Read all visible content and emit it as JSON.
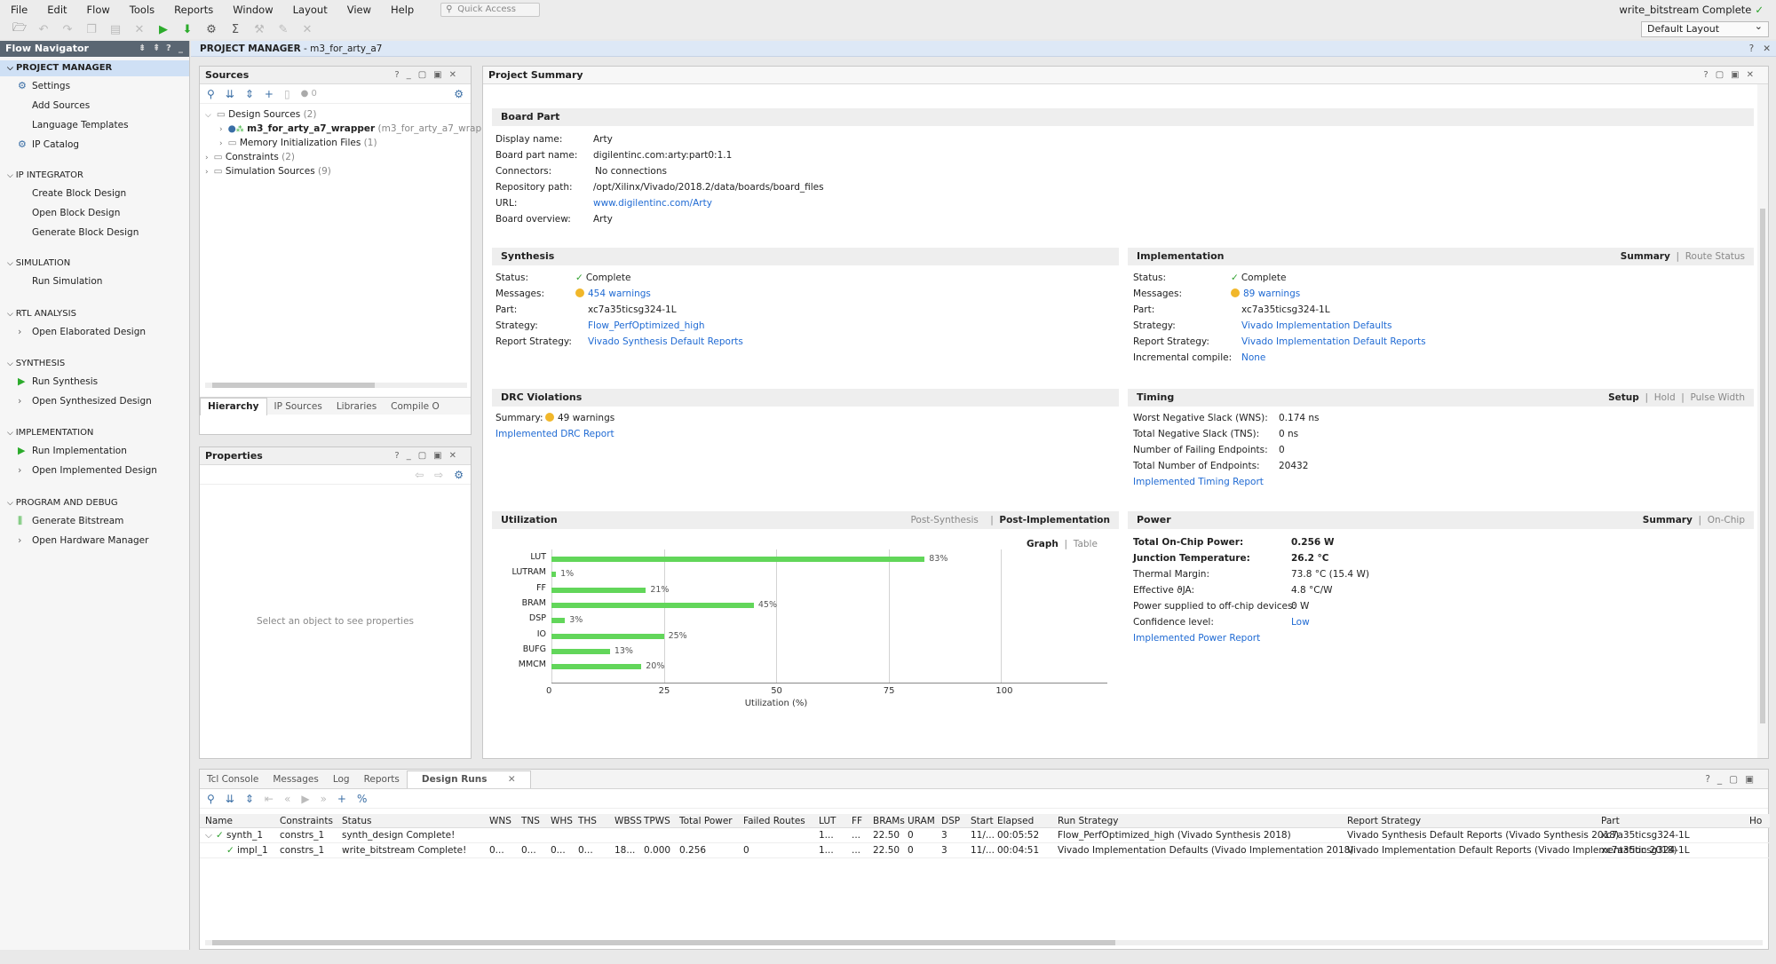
{
  "menu": {
    "items": [
      "File",
      "Edit",
      "Flow",
      "Tools",
      "Reports",
      "Window",
      "Layout",
      "View",
      "Help"
    ],
    "quick_access": "Quick Access"
  },
  "status": {
    "text": "write_bitstream Complete",
    "check": "✓"
  },
  "layout": {
    "selected": "Default Layout"
  },
  "flow_nav": {
    "title": "Flow Navigator",
    "project_manager": "PROJECT MANAGER",
    "settings": "Settings",
    "add_sources": "Add Sources",
    "language_templates": "Language Templates",
    "ip_catalog": "IP Catalog",
    "ip_integrator": "IP INTEGRATOR",
    "create_bd": "Create Block Design",
    "open_bd": "Open Block Design",
    "generate_bd": "Generate Block Design",
    "simulation": "SIMULATION",
    "run_sim": "Run Simulation",
    "rtl": "RTL ANALYSIS",
    "open_elab": "Open Elaborated Design",
    "synthesis": "SYNTHESIS",
    "run_synth": "Run Synthesis",
    "open_synth": "Open Synthesized Design",
    "implementation": "IMPLEMENTATION",
    "run_impl": "Run Implementation",
    "open_impl": "Open Implemented Design",
    "pgm": "PROGRAM AND DEBUG",
    "gen_bit": "Generate Bitstream",
    "open_hw": "Open Hardware Manager"
  },
  "pm": {
    "label": "PROJECT MANAGER",
    "project": " - m3_for_arty_a7"
  },
  "sources": {
    "title": "Sources",
    "badge": "0",
    "design_sources": "Design Sources",
    "design_count": "(2)",
    "wrapper": "m3_for_arty_a7_wrapper",
    "wrapper_suffix": "(m3_for_arty_a7_wrapp",
    "mem_init": "Memory Initialization Files",
    "mem_count": "(1)",
    "constraints": "Constraints",
    "constraints_count": "(2)",
    "sim_sources": "Simulation Sources",
    "sim_count": "(9)",
    "tabs": [
      "Hierarchy",
      "IP Sources",
      "Libraries",
      "Compile O"
    ]
  },
  "properties": {
    "title": "Properties",
    "empty": "Select an object to see properties"
  },
  "summary": {
    "title": "Project Summary",
    "board": {
      "title": "Board Part",
      "rows": [
        [
          "Display name:",
          "Arty"
        ],
        [
          "Board part name:",
          "digilentinc.com:arty:part0:1.1"
        ],
        [
          "Connectors:",
          "No connections"
        ],
        [
          "Repository path:",
          "/opt/Xilinx/Vivado/2018.2/data/boards/board_files"
        ],
        [
          "URL:",
          "www.digilentinc.com/Arty"
        ],
        [
          "Board overview:",
          "Arty"
        ]
      ]
    },
    "synthesis": {
      "title": "Synthesis",
      "status_k": "Status:",
      "status_v": "Complete",
      "messages_k": "Messages:",
      "messages_v": "454 warnings",
      "part_k": "Part:",
      "part_v": "xc7a35ticsg324-1L",
      "strategy_k": "Strategy:",
      "strategy_v": "Flow_PerfOptimized_high",
      "report_k": "Report Strategy:",
      "report_v": "Vivado Synthesis Default Reports"
    },
    "implementation": {
      "title": "Implementation",
      "tab1": "Summary",
      "tab2": "Route Status",
      "status_k": "Status:",
      "status_v": "Complete",
      "messages_k": "Messages:",
      "messages_v": "89 warnings",
      "part_k": "Part:",
      "part_v": "xc7a35ticsg324-1L",
      "strategy_k": "Strategy:",
      "strategy_v": "Vivado Implementation Defaults",
      "report_k": "Report Strategy:",
      "report_v": "Vivado Implementation Default Reports",
      "inc_k": "Incremental compile:",
      "inc_v": "None"
    },
    "drc": {
      "title": "DRC Violations",
      "summary_k": "Summary:",
      "summary_v": "49 warnings",
      "link": "Implemented DRC Report"
    },
    "timing": {
      "title": "Timing",
      "tab1": "Setup",
      "tab2": "Hold",
      "tab3": "Pulse Width",
      "rows": [
        [
          "Worst Negative Slack (WNS):",
          "0.174 ns"
        ],
        [
          "Total Negative Slack (TNS):",
          "0 ns"
        ],
        [
          "Number of Failing Endpoints:",
          "0"
        ],
        [
          "Total Number of Endpoints:",
          "20432"
        ]
      ],
      "link": "Implemented Timing Report"
    },
    "utilization": {
      "title": "Utilization",
      "tab1": "Post-Synthesis",
      "tab2": "Post-Implementation",
      "view1": "Graph",
      "view2": "Table"
    },
    "power": {
      "title": "Power",
      "tab1": "Summary",
      "tab2": "On-Chip",
      "rows": [
        [
          "Total On-Chip Power:",
          "0.256 W"
        ],
        [
          "Junction Temperature:",
          "26.2 °C"
        ],
        [
          "Thermal Margin:",
          "73.8 °C (15.4 W)"
        ],
        [
          "Effective ϑJA:",
          "4.8 °C/W"
        ],
        [
          "Power supplied to off-chip devices:",
          "0 W"
        ],
        [
          "Confidence level:",
          "Low"
        ]
      ],
      "link": "Implemented Power Report"
    }
  },
  "chart_data": {
    "type": "bar",
    "orientation": "horizontal",
    "categories": [
      "LUT",
      "LUTRAM",
      "FF",
      "BRAM",
      "DSP",
      "IO",
      "BUFG",
      "MMCM"
    ],
    "values": [
      83,
      1,
      21,
      45,
      3,
      25,
      13,
      20
    ],
    "value_labels": [
      "83%",
      "1%",
      "21%",
      "45%",
      "3%",
      "25%",
      "13%",
      "20%"
    ],
    "xlabel": "Utilization (%)",
    "ticks": [
      "0",
      "25",
      "50",
      "75",
      "100"
    ],
    "xlim": [
      0,
      100
    ],
    "bar_color": "#62d65a"
  },
  "bottom": {
    "tabs": [
      "Tcl Console",
      "Messages",
      "Log",
      "Reports",
      "Design Runs"
    ],
    "headers": [
      "Name",
      "Constraints",
      "Status",
      "WNS",
      "TNS",
      "WHS",
      "THS",
      "WBSS",
      "TPWS",
      "Total Power",
      "Failed Routes",
      "LUT",
      "FF",
      "BRAMs",
      "URAM",
      "DSP",
      "Start",
      "Elapsed",
      "Run Strategy",
      "Report Strategy",
      "Part",
      "Ho"
    ],
    "rows": [
      [
        "synth_1",
        "constrs_1",
        "synth_design Complete!",
        "",
        "",
        "",
        "",
        "",
        "",
        "",
        "",
        "1...",
        "...",
        "22.50",
        "0",
        "3",
        "11/...",
        "00:05:52",
        "Flow_PerfOptimized_high (Vivado Synthesis 2018)",
        "Vivado Synthesis Default Reports (Vivado Synthesis 2018)",
        "xc7a35ticsg324-1L",
        ""
      ],
      [
        "impl_1",
        "constrs_1",
        "write_bitstream Complete!",
        "0...",
        "0...",
        "0...",
        "0...",
        "18...",
        "0.000",
        "0.256",
        "0",
        "1...",
        "...",
        "22.50",
        "0",
        "3",
        "11/...",
        "00:04:51",
        "Vivado Implementation Defaults (Vivado Implementation 2018)",
        "Vivado Implementation Default Reports (Vivado Implementation 2018)",
        "xc7a35ticsg324-1L",
        ""
      ]
    ]
  }
}
